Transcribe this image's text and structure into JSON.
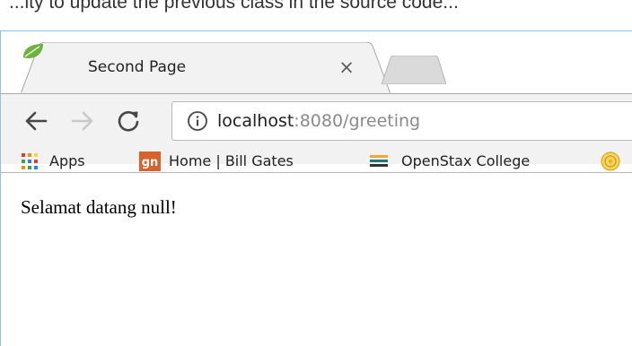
{
  "caption": {
    "text": "...ity to update the previous class in the source code..."
  },
  "tabs": [
    {
      "title": "Second Page",
      "favicon": "spring-leaf-icon",
      "close_glyph": "×",
      "active": true
    },
    {
      "title": "",
      "favicon": "",
      "active": false
    }
  ],
  "toolbar": {
    "back_icon": "arrow-left-icon",
    "forward_icon": "arrow-right-icon",
    "reload_icon": "reload-icon",
    "address": {
      "info_icon": "info-icon",
      "host": "localhost",
      "rest": ":8080/greeting"
    }
  },
  "bookmarks": [
    {
      "label": "Apps",
      "icon": "apps-grid-icon"
    },
    {
      "label": "Home | Bill Gates",
      "icon": "gn-logo-icon"
    },
    {
      "label": "OpenStax College",
      "icon": "openstax-stack-icon"
    },
    {
      "label": "",
      "icon": "university-seal-icon"
    }
  ],
  "page": {
    "greeting": "Selamat datang null!"
  },
  "colors": {
    "window_border": "#8fc3e6",
    "toolbar_bg": "#f2f2f2",
    "url_rest": "#8a8a8a",
    "spring_green": "#6db33f",
    "gn_orange": "#d9622b"
  }
}
